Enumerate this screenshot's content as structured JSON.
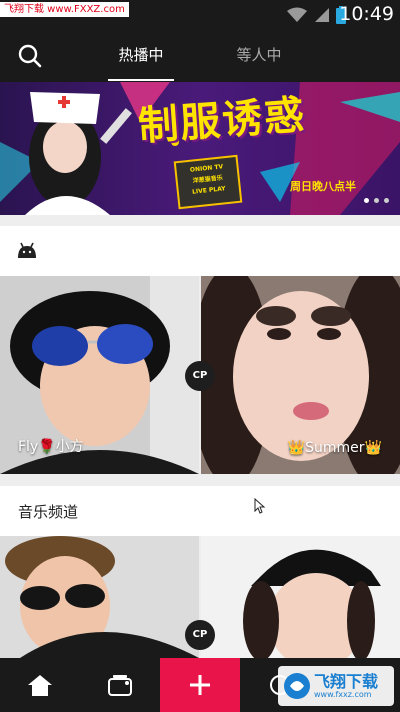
{
  "status_bar": {
    "watermark": "飞翔下载 www.FXXZ.com",
    "time": "10:49",
    "icons": [
      "wifi-icon",
      "signal-icon",
      "battery-icon"
    ]
  },
  "header": {
    "search_icon": "search-icon",
    "tabs": [
      {
        "label": "热播中",
        "active": true
      },
      {
        "label": "等人中",
        "active": false
      }
    ]
  },
  "banner": {
    "title": "制服诱惑",
    "subtitle": "周日晚八点半",
    "badge_lines": [
      "ONION TV",
      "洋葱猫音乐",
      "LIVE PLAY"
    ],
    "page_count": 3,
    "active_page": 1
  },
  "sections": [
    {
      "icon": "android-icon",
      "title": "",
      "cards": [
        {
          "name": "Fly🌹小方"
        },
        {
          "name": "👑Summer👑"
        }
      ],
      "badge": "CP"
    },
    {
      "title": "音乐频道",
      "cards": [
        {
          "name": ""
        },
        {
          "name": ""
        }
      ],
      "badge": "CP"
    }
  ],
  "bottom_nav": {
    "items": [
      "home-icon",
      "live-rooms-icon",
      "add-icon",
      "message-icon"
    ]
  },
  "watermark_bottom": {
    "text": "飞翔下载",
    "url": "www.fxxz.com"
  },
  "colors": {
    "accent": "#e8144a",
    "dark_bar": "#1a1a1a",
    "banner_yellow": "#ffe400",
    "banner_purple": "#6a1b8a"
  }
}
